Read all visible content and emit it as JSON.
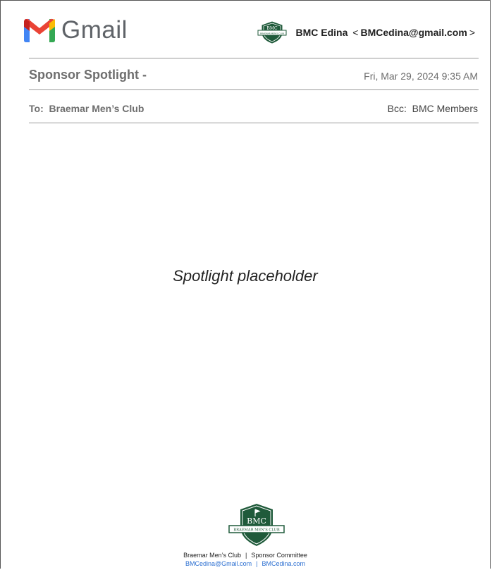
{
  "header": {
    "brand": "Gmail",
    "sender_name": "BMC Edina",
    "sender_email": "BMCedina@gmail.com",
    "crest_text": "BMC",
    "crest_subtext": "BRAEMAR MEN'S CLUB"
  },
  "message": {
    "subject": "Sponsor Spotlight -",
    "date": "Fri, Mar 29, 2024 9:35 AM",
    "to_label": "To:",
    "to_value": "Braemar Men’s Club",
    "bcc_label": "Bcc:",
    "bcc_value": "BMC Members",
    "body_placeholder": "Spotlight placeholder"
  },
  "footer": {
    "org": "Braemar Men’s Club",
    "committee": "Sponsor Committee",
    "email": "BMCedina@Gmail.com",
    "website": "BMCedina.com",
    "separator": "|"
  },
  "colors": {
    "crest_green": "#1f5a3a",
    "link_blue": "#2c6fd1",
    "gmail_red": "#ea4335",
    "gmail_blue": "#4285f4",
    "gmail_green": "#34a853",
    "gmail_yellow": "#fbbc04"
  }
}
